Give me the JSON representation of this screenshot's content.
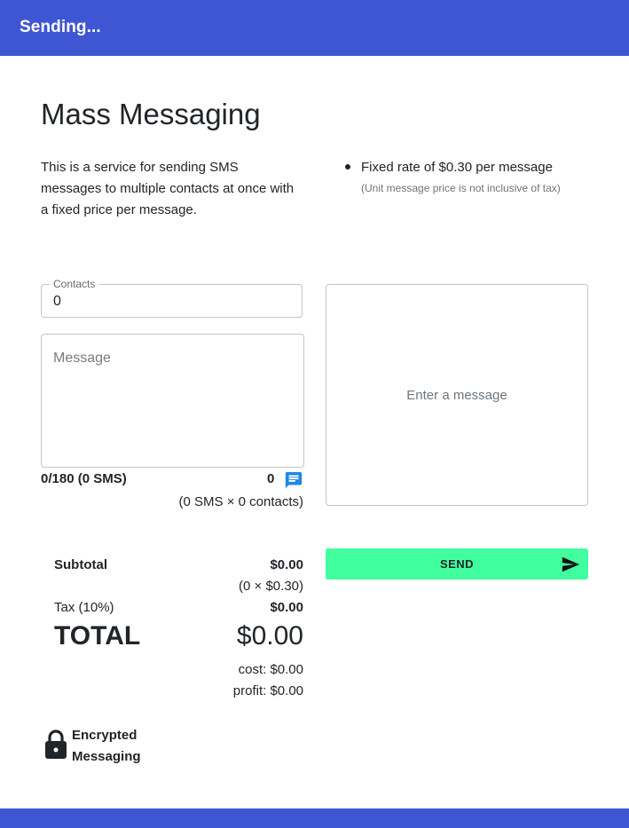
{
  "header": {
    "title": "Sending..."
  },
  "page": {
    "title": "Mass Messaging",
    "description": "This is a service for sending SMS messages to multiple contacts at once with a fixed price per message.",
    "feature": "Fixed rate of $0.30 per message",
    "feature_note": "(Unit message price is not inclusive of tax)"
  },
  "form": {
    "contacts_label": "Contacts",
    "contacts_value": "0",
    "message_placeholder": "Message",
    "char_count": "0/180 (0 SMS)",
    "sms_count": "0",
    "sms_formula": "(0 SMS × 0 contacts)"
  },
  "preview": {
    "placeholder": "Enter a message"
  },
  "send": {
    "label": "SEND"
  },
  "summary": {
    "subtotal_label": "Subtotal",
    "subtotal_value": "$0.00",
    "subtotal_formula": "(0 × $0.30)",
    "tax_label": "Tax (10%)",
    "tax_value": "$0.00",
    "total_label": "TOTAL",
    "total_value": "$0.00",
    "cost": "cost: $0.00",
    "profit": "profit: $0.00"
  },
  "security": {
    "label": "Encrypted Messaging"
  },
  "colors": {
    "brand": "#3f56d3",
    "send": "#41ff9e",
    "sms_icon": "#1e88e5"
  },
  "icons": {
    "sms": "sms-icon",
    "send": "send-icon",
    "lock": "lock-icon"
  }
}
